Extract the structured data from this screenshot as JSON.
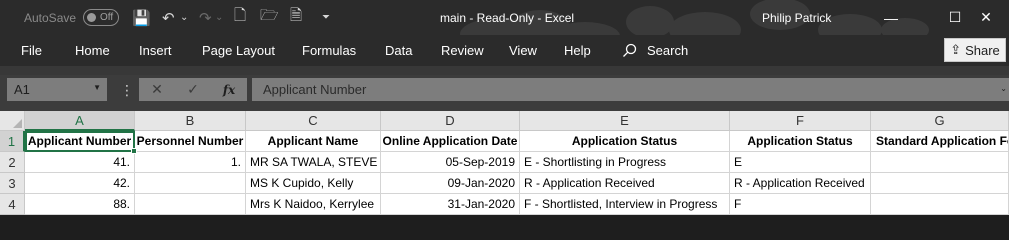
{
  "titlebar": {
    "autosave_label": "AutoSave",
    "autosave_state": "Off",
    "title": "main  -  Read-Only  -  Excel",
    "user": "Philip Patrick",
    "minimize": "—",
    "restore": "☐",
    "close": "✕"
  },
  "qat": {
    "save_icon": "💾",
    "undo_icon": "↶",
    "undo_dd": "⌄",
    "redo_icon": "↷",
    "redo_dd": "⌄",
    "new_icon": "🗋",
    "open_icon": "🗁",
    "print_icon": "🗎",
    "customize": "⏷"
  },
  "ribbon": {
    "tabs": [
      "File",
      "Home",
      "Insert",
      "Page Layout",
      "Formulas",
      "Data",
      "Review",
      "View",
      "Help"
    ],
    "search_label": "Search",
    "share_label": "Share"
  },
  "formula_bar": {
    "name_box": "A1",
    "cancel": "✕",
    "enter": "✓",
    "fx": "fx",
    "content": "Applicant Number"
  },
  "grid": {
    "columns": [
      "A",
      "B",
      "C",
      "D",
      "E",
      "F",
      "G"
    ],
    "rows": [
      "1",
      "2",
      "3",
      "4"
    ],
    "header_row": [
      "Applicant Number",
      "Personnel Number",
      "Applicant Name",
      "Online Application Date",
      "Application Status",
      "Application Status",
      "Standard Application Fo"
    ],
    "data_rows": [
      [
        "41.",
        "1.",
        "MR SA TWALA, STEVE",
        "05-Sep-2019",
        "E - Shortlisting in Progress",
        "E",
        ""
      ],
      [
        "42.",
        "",
        "MS K Cupido, Kelly",
        "09-Jan-2020",
        "R - Application Received",
        "R - Application Received",
        ""
      ],
      [
        "88.",
        "",
        "Mrs K Naidoo, Kerrylee",
        "31-Jan-2020",
        "F - Shortlisted, Interview in Progress",
        "F",
        ""
      ]
    ]
  },
  "colors": {
    "accent": "#217346",
    "titlebar": "#2b2b2b"
  }
}
